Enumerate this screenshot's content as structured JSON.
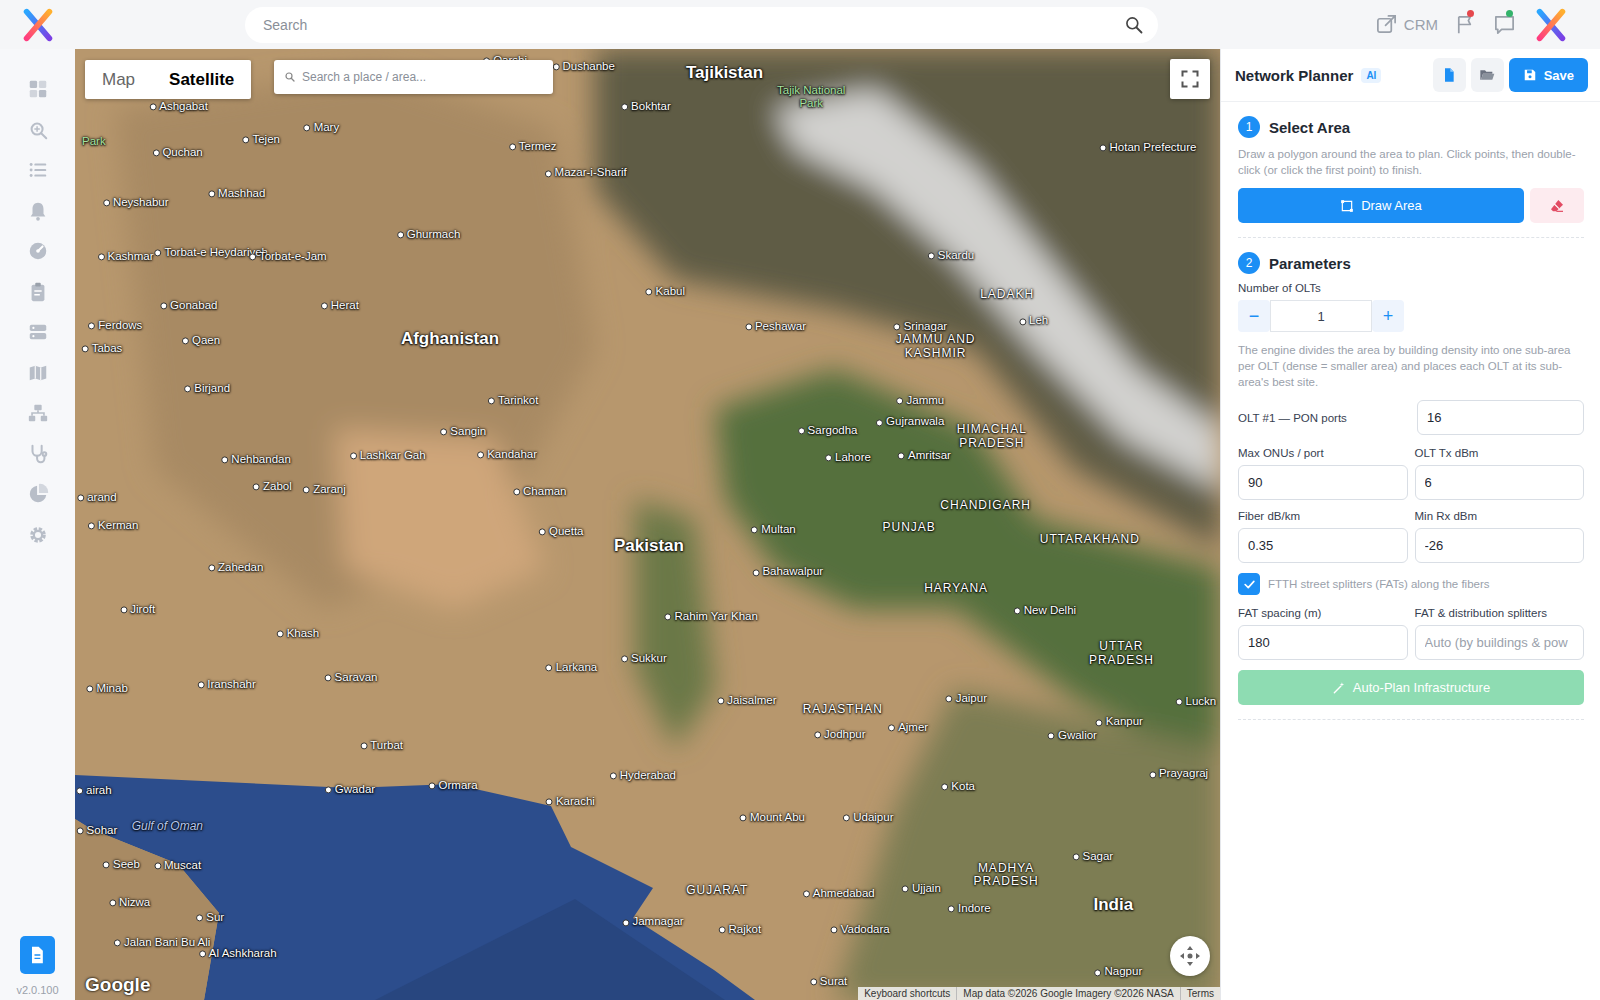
{
  "topbar": {
    "search_placeholder": "Search",
    "crm_label": "CRM",
    "alerts": [
      {
        "color": "#e5484d"
      },
      {
        "color": "#34b36b"
      }
    ]
  },
  "sidebar": {
    "version": "v2.0.100"
  },
  "map": {
    "mode_tabs": [
      {
        "label": "Map",
        "selected": false
      },
      {
        "label": "Satellite",
        "selected": true
      }
    ],
    "search_placeholder": "Search a place / area...",
    "logo": "Google",
    "attribution": [
      "Keyboard shortcuts",
      "Map data ©2026 Google Imagery ©2026 NASA",
      "Terms"
    ],
    "labels": [
      {
        "text": "Ashgabat",
        "kind": "city"
      },
      {
        "text": "Mary",
        "kind": "city"
      },
      {
        "text": "Tejen",
        "kind": "city"
      },
      {
        "text": "Qarshi",
        "kind": "city"
      },
      {
        "text": "Dushanbe",
        "kind": "city"
      },
      {
        "text": "Tajikistan",
        "kind": "country"
      },
      {
        "text": "Tajik National Park",
        "kind": "park"
      },
      {
        "text": "Bokhtar",
        "kind": "city"
      },
      {
        "text": "Termez",
        "kind": "city"
      },
      {
        "text": "Mazar-i-Sharif",
        "kind": "city"
      },
      {
        "text": "Hotan Prefecture",
        "kind": "city"
      },
      {
        "text": "Quchan",
        "kind": "city"
      },
      {
        "text": "Mashhad",
        "kind": "city"
      },
      {
        "text": "Neyshabur",
        "kind": "city"
      },
      {
        "text": "Kashmar",
        "kind": "city"
      },
      {
        "text": "Torbat-e Heydariyeh",
        "kind": "city"
      },
      {
        "text": "Torbat-e-Jam",
        "kind": "city"
      },
      {
        "text": "Ghurmach",
        "kind": "city"
      },
      {
        "text": "Skardu",
        "kind": "city"
      },
      {
        "text": "Kabul",
        "kind": "city"
      },
      {
        "text": "LADAKH",
        "kind": "region"
      },
      {
        "text": "Gonabad",
        "kind": "city"
      },
      {
        "text": "Herat",
        "kind": "city"
      },
      {
        "text": "Ferdows",
        "kind": "city"
      },
      {
        "text": "Peshawar",
        "kind": "city"
      },
      {
        "text": "Srinagar",
        "kind": "city"
      },
      {
        "text": "Leh",
        "kind": "city"
      },
      {
        "text": "Afghanistan",
        "kind": "country"
      },
      {
        "text": "Qaen",
        "kind": "city"
      },
      {
        "text": "Tabas",
        "kind": "city"
      },
      {
        "text": "JAMMU AND KASHMIR",
        "kind": "region"
      },
      {
        "text": "Birjand",
        "kind": "city"
      },
      {
        "text": "Tarinkot",
        "kind": "city"
      },
      {
        "text": "Jammu",
        "kind": "city"
      },
      {
        "text": "Gujranwala",
        "kind": "city"
      },
      {
        "text": "Sargodha",
        "kind": "city"
      },
      {
        "text": "Sangin",
        "kind": "city"
      },
      {
        "text": "HIMACHAL PRADESH",
        "kind": "region"
      },
      {
        "text": "Amritsar",
        "kind": "city"
      },
      {
        "text": "Lahore",
        "kind": "city"
      },
      {
        "text": "Lashkar Gah",
        "kind": "city"
      },
      {
        "text": "Kandahar",
        "kind": "city"
      },
      {
        "text": "Nehbandan",
        "kind": "city"
      },
      {
        "text": "Zabol",
        "kind": "city"
      },
      {
        "text": "Zaranj",
        "kind": "city"
      },
      {
        "text": "Chaman",
        "kind": "city"
      },
      {
        "text": "arand",
        "kind": "city"
      },
      {
        "text": "CHANDIGARH",
        "kind": "region"
      },
      {
        "text": "Kerman",
        "kind": "city"
      },
      {
        "text": "Multan",
        "kind": "city"
      },
      {
        "text": "PUNJAB",
        "kind": "region"
      },
      {
        "text": "Quetta",
        "kind": "city"
      },
      {
        "text": "UTTARAKHAND",
        "kind": "region"
      },
      {
        "text": "Pakistan",
        "kind": "country"
      },
      {
        "text": "Zahedan",
        "kind": "city"
      },
      {
        "text": "Bahawalpur",
        "kind": "city"
      },
      {
        "text": "HARYANA",
        "kind": "region"
      },
      {
        "text": "Jiroft",
        "kind": "city"
      },
      {
        "text": "New Delhi",
        "kind": "city"
      },
      {
        "text": "Rahim Yar Khan",
        "kind": "city"
      },
      {
        "text": "Khash",
        "kind": "city"
      },
      {
        "text": "UTTAR PRADESH",
        "kind": "region"
      },
      {
        "text": "Sukkur",
        "kind": "city"
      },
      {
        "text": "Larkana",
        "kind": "city"
      },
      {
        "text": "Saravan",
        "kind": "city"
      },
      {
        "text": "Iranshahr",
        "kind": "city"
      },
      {
        "text": "Minab",
        "kind": "city"
      },
      {
        "text": "Jaipur",
        "kind": "city"
      },
      {
        "text": "Jaisalmer",
        "kind": "city"
      },
      {
        "text": "Luckn",
        "kind": "city"
      },
      {
        "text": "RAJASTHAN",
        "kind": "region"
      },
      {
        "text": "Kanpur",
        "kind": "city"
      },
      {
        "text": "Ajmer",
        "kind": "city"
      },
      {
        "text": "Jodhpur",
        "kind": "city"
      },
      {
        "text": "Gwalior",
        "kind": "city"
      },
      {
        "text": "Turbat",
        "kind": "city"
      },
      {
        "text": "Prayagraj",
        "kind": "city"
      },
      {
        "text": "Hyderabad",
        "kind": "city"
      },
      {
        "text": "Ormara",
        "kind": "city"
      },
      {
        "text": "Kota",
        "kind": "city"
      },
      {
        "text": "Gwadar",
        "kind": "city"
      },
      {
        "text": "Karachi",
        "kind": "city"
      },
      {
        "text": "Mount Abu",
        "kind": "city"
      },
      {
        "text": "Udaipur",
        "kind": "city"
      },
      {
        "text": "Gulf of Oman",
        "kind": "water"
      },
      {
        "text": "Sohar",
        "kind": "city"
      },
      {
        "text": "Sagar",
        "kind": "city"
      },
      {
        "text": "Muscat",
        "kind": "city"
      },
      {
        "text": "Seeb",
        "kind": "city"
      },
      {
        "text": "MADHYA PRADESH",
        "kind": "region"
      },
      {
        "text": "Ujjain",
        "kind": "city"
      },
      {
        "text": "GUJARAT",
        "kind": "region"
      },
      {
        "text": "Ahmedabad",
        "kind": "city"
      },
      {
        "text": "Nizwa",
        "kind": "city"
      },
      {
        "text": "India",
        "kind": "country"
      },
      {
        "text": "Indore",
        "kind": "city"
      },
      {
        "text": "Sur",
        "kind": "city"
      },
      {
        "text": "Jamnagar",
        "kind": "city"
      },
      {
        "text": "Rajkot",
        "kind": "city"
      },
      {
        "text": "Vadodara",
        "kind": "city"
      },
      {
        "text": "Jalan Bani Bu Ali",
        "kind": "city"
      },
      {
        "text": "Al Ashkharah",
        "kind": "city"
      },
      {
        "text": "Surat",
        "kind": "city"
      },
      {
        "text": "Nagpur",
        "kind": "city"
      },
      {
        "text": "airah",
        "kind": "city"
      },
      {
        "text": "Park",
        "kind": "park"
      }
    ]
  },
  "planner": {
    "title": "Network Planner",
    "badge": "AI",
    "save_label": "Save",
    "select_area": {
      "number": "1",
      "title": "Select Area",
      "hint": "Draw a polygon around the area to plan. Click points, then double-click (or click the first point) to finish.",
      "draw_button": "Draw Area"
    },
    "parameters": {
      "number": "2",
      "title": "Parameters",
      "olt_count_label": "Number of OLTs",
      "olt_count": "1",
      "decrement": "−",
      "increment": "+",
      "hint": "The engine divides the area by building density into one sub-area per OLT (dense = smaller area) and places each OLT at its sub-area's best site.",
      "olts": [
        {
          "label": "OLT #1 — PON ports",
          "value": "16"
        }
      ],
      "fields": [
        {
          "label": "Max ONUs / port",
          "value": "90"
        },
        {
          "label": "OLT Tx dBm",
          "value": "6"
        },
        {
          "label": "Fiber dB/km",
          "value": "0.35"
        },
        {
          "label": "Min Rx dBm",
          "value": "-26"
        }
      ],
      "fat_checkbox": {
        "label": "FTTH street splitters (FATs) along the fibers",
        "checked": true
      },
      "fat_fields": [
        {
          "label": "FAT spacing (m)",
          "value": "180",
          "placeholder": ""
        },
        {
          "label": "FAT & distribution splitters",
          "value": "",
          "placeholder": "Auto (by buildings & pow"
        }
      ],
      "auto_plan": {
        "label": "Auto-Plan Infrastructure",
        "disabled": true
      }
    }
  }
}
